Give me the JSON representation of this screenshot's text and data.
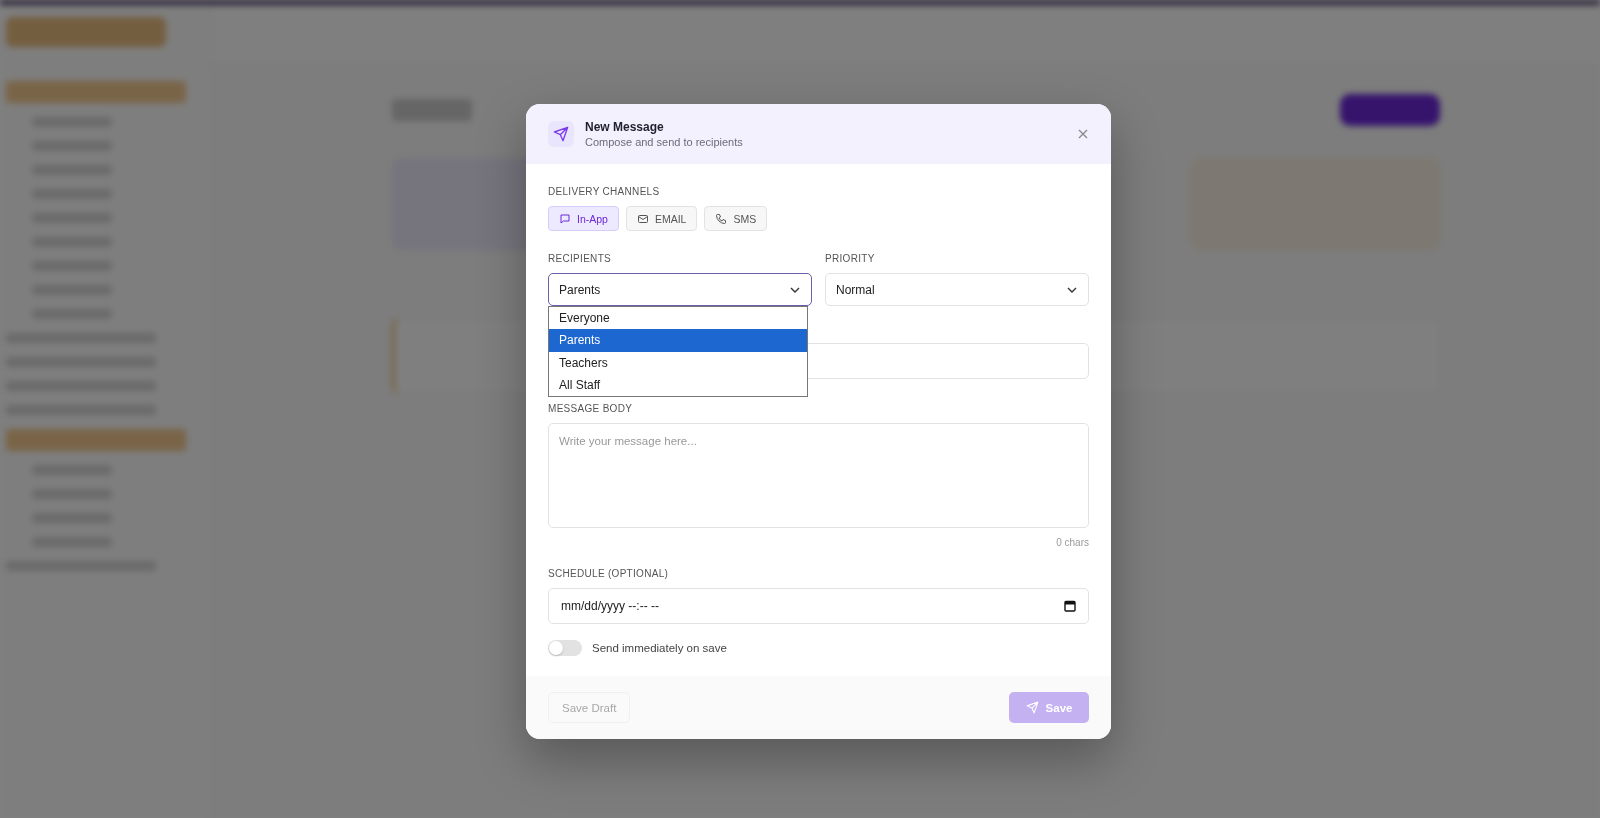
{
  "modal": {
    "title": "New Message",
    "subtitle": "Compose and send to recipients"
  },
  "channels_label": "DELIVERY CHANNELS",
  "channels": [
    {
      "label": "In-App",
      "selected": true,
      "kind": "chat"
    },
    {
      "label": "EMAIL",
      "selected": false,
      "kind": "mail"
    },
    {
      "label": "SMS",
      "selected": false,
      "kind": "phone"
    }
  ],
  "recipients": {
    "label": "RECIPIENTS",
    "value": "Parents",
    "open": true,
    "options": [
      {
        "label": "Everyone",
        "selected": false
      },
      {
        "label": "Parents",
        "selected": true
      },
      {
        "label": "Teachers",
        "selected": false
      },
      {
        "label": "All Staff",
        "selected": false
      }
    ]
  },
  "priority": {
    "label": "PRIORITY",
    "value": "Normal"
  },
  "message_body": {
    "label": "MESSAGE BODY",
    "placeholder": "Write your message here...",
    "counter": "0 chars"
  },
  "schedule": {
    "label": "SCHEDULE (OPTIONAL)",
    "value": "mm/dd/yyyy --:-- --"
  },
  "send_immediately": {
    "label": "Send immediately on save",
    "on": false
  },
  "footer": {
    "save_draft": "Save Draft",
    "save": "Save",
    "save_disabled": true
  }
}
